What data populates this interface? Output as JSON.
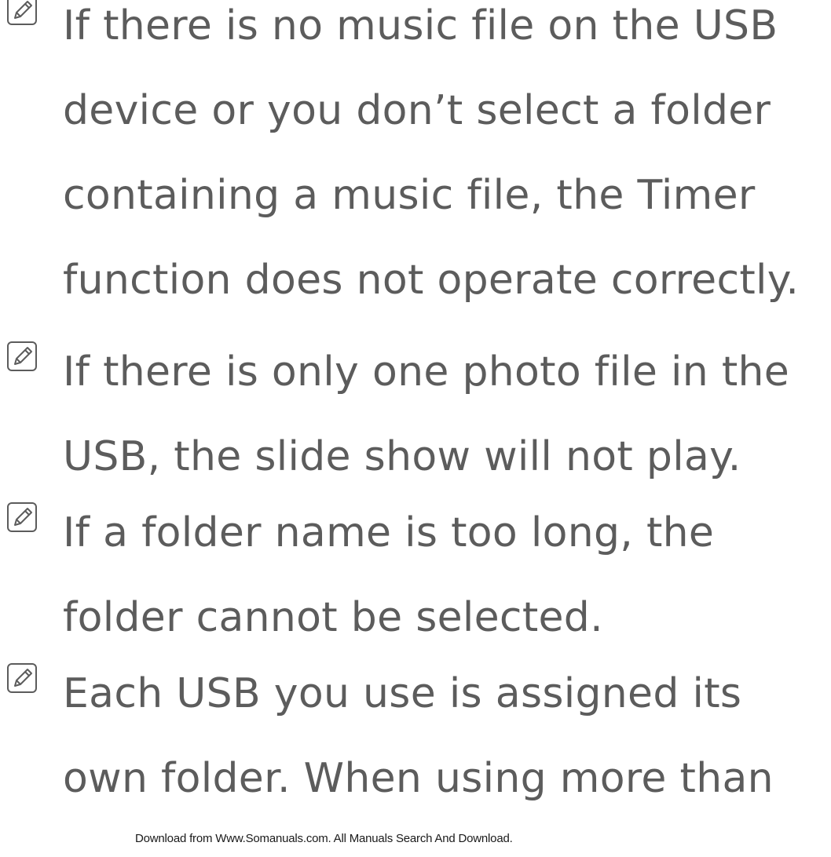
{
  "notes": [
    {
      "icon": "note-pencil-icon",
      "text": "If there is no music file on the USB device or you don’t select a folder containing a music file, the Timer function does not operate correctly."
    },
    {
      "icon": "note-pencil-icon",
      "text": "If there is only one photo file in the USB, the slide show will not play."
    },
    {
      "icon": "note-pencil-icon",
      "text": "If a folder name is too long, the folder cannot be selected."
    },
    {
      "icon": "note-pencil-icon",
      "text": "Each USB you use is assigned its own folder. When using more than"
    }
  ],
  "watermark": "Download from Www.Somanuals.com. All Manuals Search And Download.",
  "colors": {
    "text": "#5c5c5c",
    "icon": "#5c5c5c",
    "background": "#ffffff"
  }
}
